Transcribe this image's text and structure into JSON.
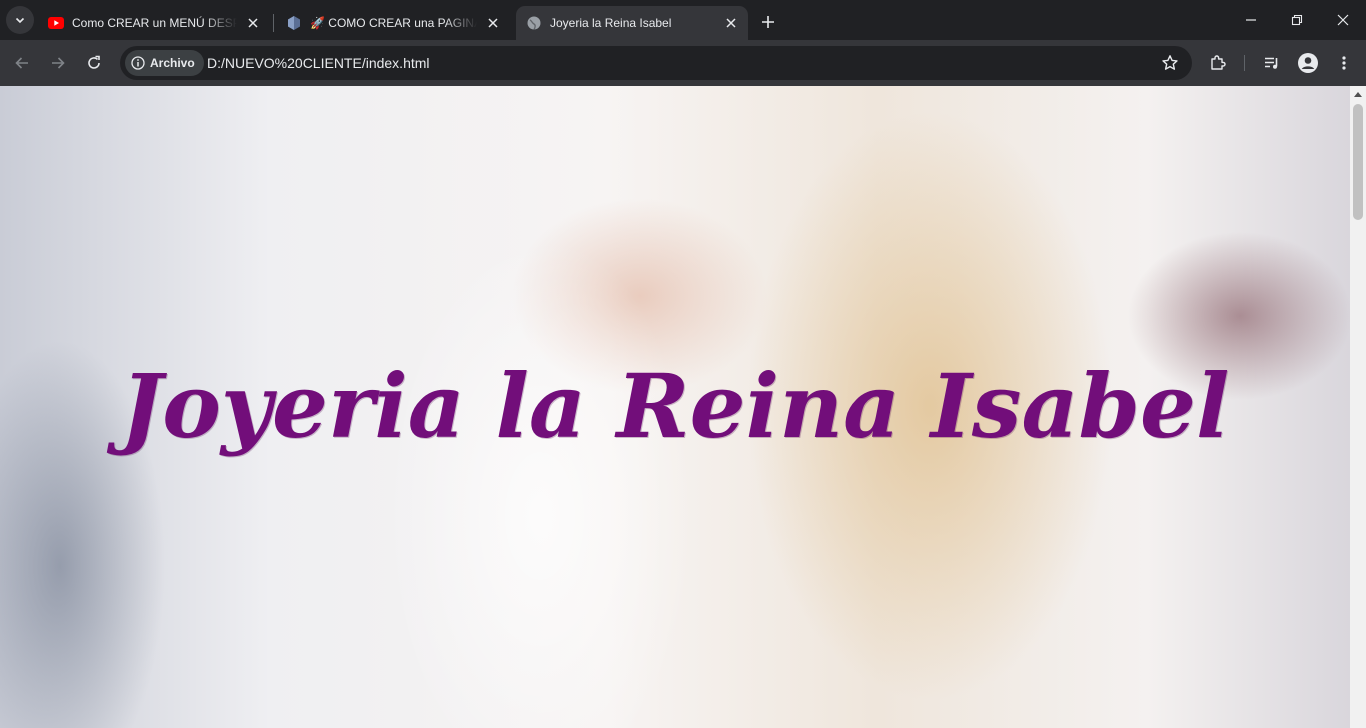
{
  "browser": {
    "tabs": [
      {
        "title": "Como CREAR un MENÚ DESPLEGABLE",
        "favicon": "youtube-icon"
      },
      {
        "title": "🚀 COMO CREAR una PAGINA WEB",
        "favicon": "site-icon"
      },
      {
        "title": "Joyeria la Reina Isabel",
        "favicon": "globe-icon",
        "active": true
      }
    ],
    "site_chip": "Archivo",
    "url": "D:/NUEVO%20CLIENTE/index.html"
  },
  "page": {
    "title": "Joyeria la Reina Isabel",
    "title_color": "#720e7a"
  }
}
